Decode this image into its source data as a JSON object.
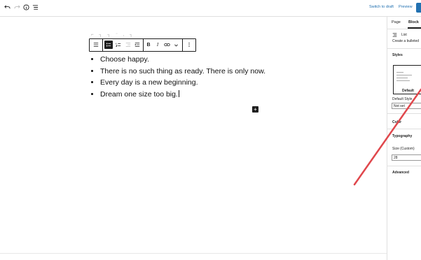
{
  "topbar": {
    "switch_to_draft": "Switch to draft",
    "preview": "Preview",
    "icons": [
      "undo-icon",
      "redo-icon",
      "info-icon",
      "list-view-icon"
    ]
  },
  "toolbar": {
    "icons": [
      "list-block-icon",
      "unordered-list-icon",
      "ordered-list-icon",
      "outdent-icon",
      "indent-icon",
      "bold-icon",
      "italic-icon",
      "link-icon",
      "chevron-down-icon",
      "more-options-icon"
    ],
    "bold_label": "B",
    "italic_label": "I"
  },
  "list": {
    "items": [
      "Choose happy.",
      "There is no such thing as ready. There is only now.",
      "Every day is a new beginning.",
      "Dream one size too big."
    ]
  },
  "sidebar": {
    "tab_page": "Page",
    "tab_block": "Block",
    "block_name": "List",
    "block_desc": "Create a bulleted",
    "styles_heading": "Styles",
    "style_default_label": "Default",
    "default_style_label": "Default Style",
    "default_style_value": "Not set",
    "color_heading": "Color",
    "typography_heading": "Typography",
    "size_label": "Size (Custom)",
    "size_value": "28",
    "advanced_heading": "Advanced"
  },
  "colors": {
    "accent": "#2271b1",
    "annotation_arrow": "#e0474c"
  }
}
